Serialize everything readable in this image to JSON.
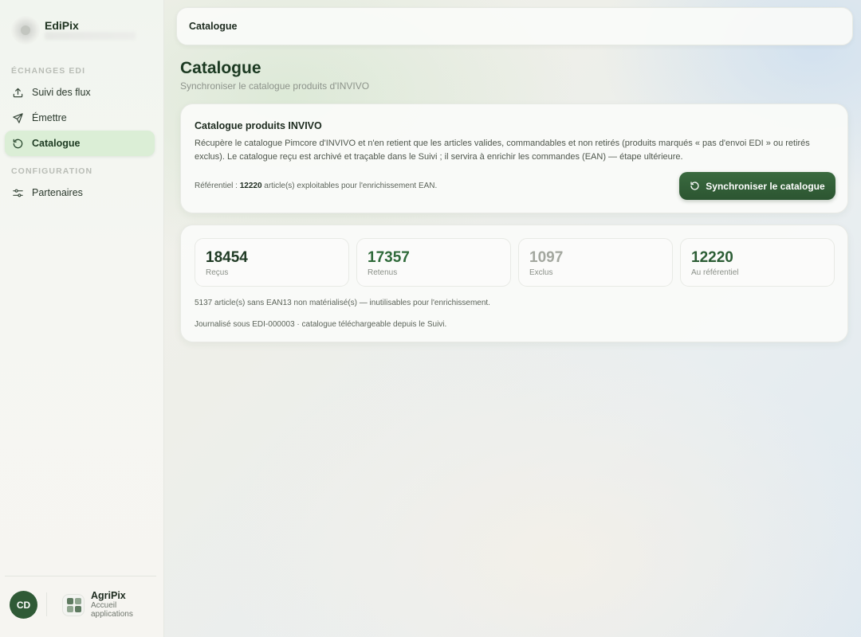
{
  "brand": {
    "name": "EdiPix"
  },
  "sidebar": {
    "sections": [
      {
        "label": "ÉCHANGES EDI"
      },
      {
        "label": "CONFIGURATION"
      }
    ],
    "items": [
      {
        "label": "Suivi des flux",
        "icon": "upload-icon"
      },
      {
        "label": "Émettre",
        "icon": "send-icon"
      },
      {
        "label": "Catalogue",
        "icon": "refresh-icon",
        "active": true
      },
      {
        "label": "Partenaires",
        "icon": "sliders-icon"
      }
    ],
    "footer": {
      "avatar_initials": "CD",
      "apps_title": "AgriPix",
      "apps_subtitle": "Accueil applications"
    }
  },
  "topbar": {
    "title": "Catalogue"
  },
  "page": {
    "title": "Catalogue",
    "subtitle": "Synchroniser le catalogue produits d'INVIVO"
  },
  "info_card": {
    "title": "Catalogue produits INVIVO",
    "description": "Récupère le catalogue Pimcore d'INVIVO et n'en retient que les articles valides, commandables et non retirés (produits marqués « pas d'envoi EDI » ou retirés exclus). Le catalogue reçu est archivé et traçable dans le Suivi ; il servira à enrichir les commandes (EAN) — étape ultérieure.",
    "ref_prefix": "Référentiel : ",
    "ref_value": "12220",
    "ref_suffix": " article(s) exploitables pour l'enrichissement EAN.",
    "sync_button": "Synchroniser le catalogue"
  },
  "stats": [
    {
      "value": "18454",
      "label": "Reçus",
      "color": "#1f3a24"
    },
    {
      "value": "17357",
      "label": "Retenus",
      "color": "#2f6a3a"
    },
    {
      "value": "1097",
      "label": "Exclus",
      "color": "#a3a79f"
    },
    {
      "value": "12220",
      "label": "Au référentiel",
      "color": "#2c5d35"
    }
  ],
  "notes": {
    "ean_missing": "5137 article(s) sans EAN13 non matérialisé(s) — inutilisables pour l'enrichissement.",
    "journal": "Journalisé sous EDI-000003 · catalogue téléchargeable depuis le Suivi."
  },
  "colors": {
    "accent": "#2f5a36",
    "active_nav": "#dbeed6"
  }
}
